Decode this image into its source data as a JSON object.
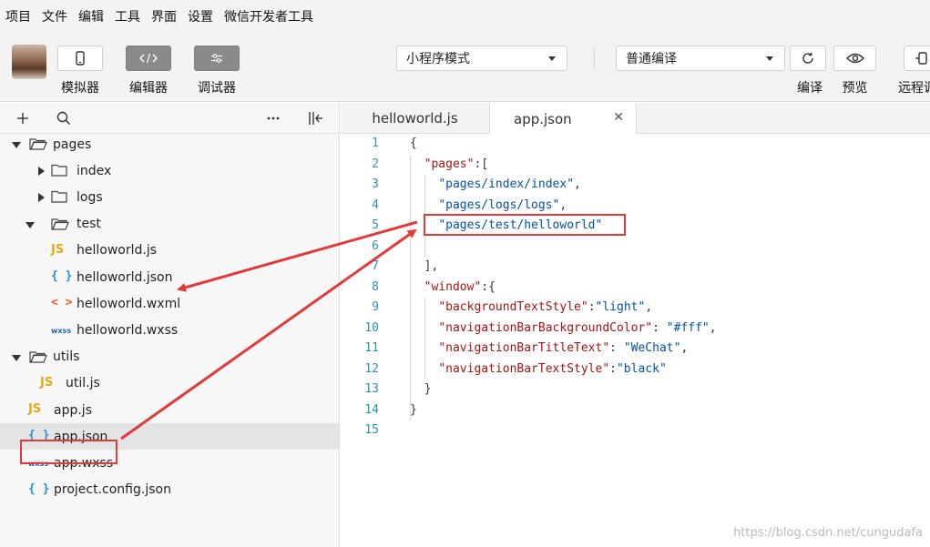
{
  "menu": [
    "项目",
    "文件",
    "编辑",
    "工具",
    "界面",
    "设置",
    "微信开发者工具"
  ],
  "toolbar": {
    "simulator": "模拟器",
    "editor": "编辑器",
    "debugger": "调试器",
    "mode_select": "小程序模式",
    "compile_select": "普通编译",
    "compile": "编译",
    "preview": "预览",
    "remote": "远程调"
  },
  "tree": [
    {
      "name": "pages",
      "type": "folder",
      "state": "open",
      "depth": 0
    },
    {
      "name": "index",
      "type": "folder",
      "state": "closed",
      "depth": 1
    },
    {
      "name": "logs",
      "type": "folder",
      "state": "closed",
      "depth": 1
    },
    {
      "name": "test",
      "type": "folder",
      "state": "open",
      "depth": 1
    },
    {
      "name": "helloworld.js",
      "type": "js",
      "depth": 2
    },
    {
      "name": "helloworld.json",
      "type": "json",
      "depth": 2
    },
    {
      "name": "helloworld.wxml",
      "type": "wxml",
      "depth": 2
    },
    {
      "name": "helloworld.wxss",
      "type": "wxss",
      "depth": 2
    },
    {
      "name": "utils",
      "type": "folder",
      "state": "open",
      "depth": 0
    },
    {
      "name": "util.js",
      "type": "js",
      "depth": 1
    },
    {
      "name": "app.js",
      "type": "js",
      "depth": 0
    },
    {
      "name": "app.json",
      "type": "json",
      "depth": 0,
      "selected": true
    },
    {
      "name": "app.wxss",
      "type": "wxss",
      "depth": 0
    },
    {
      "name": "project.config.json",
      "type": "json",
      "depth": 0
    }
  ],
  "icons": {
    "js": "JS",
    "json": "{ }",
    "wxml": "< >",
    "wxss": "wxss"
  },
  "tabs": [
    {
      "label": "helloworld.js",
      "active": false
    },
    {
      "label": "app.json",
      "active": true,
      "close": "✕"
    }
  ],
  "code_lines": [
    "{",
    "  \"pages\":[",
    "    \"pages/index/index\",",
    "    \"pages/logs/logs\",",
    "    \"pages/test/helloworld\"",
    "",
    "  ],",
    "  \"window\":{",
    "    \"backgroundTextStyle\":\"light\",",
    "    \"navigationBarBackgroundColor\": \"#fff\",",
    "    \"navigationBarTitleText\": \"WeChat\",",
    "    \"navigationBarTextStyle\":\"black\"",
    "  }",
    "}",
    ""
  ],
  "watermark": "https://blog.csdn.net/cungudafa",
  "colors": {
    "annotation": "#e03a3a",
    "line_number": "#2b91af",
    "json_key": "#a31515",
    "json_string": "#0451a5"
  }
}
